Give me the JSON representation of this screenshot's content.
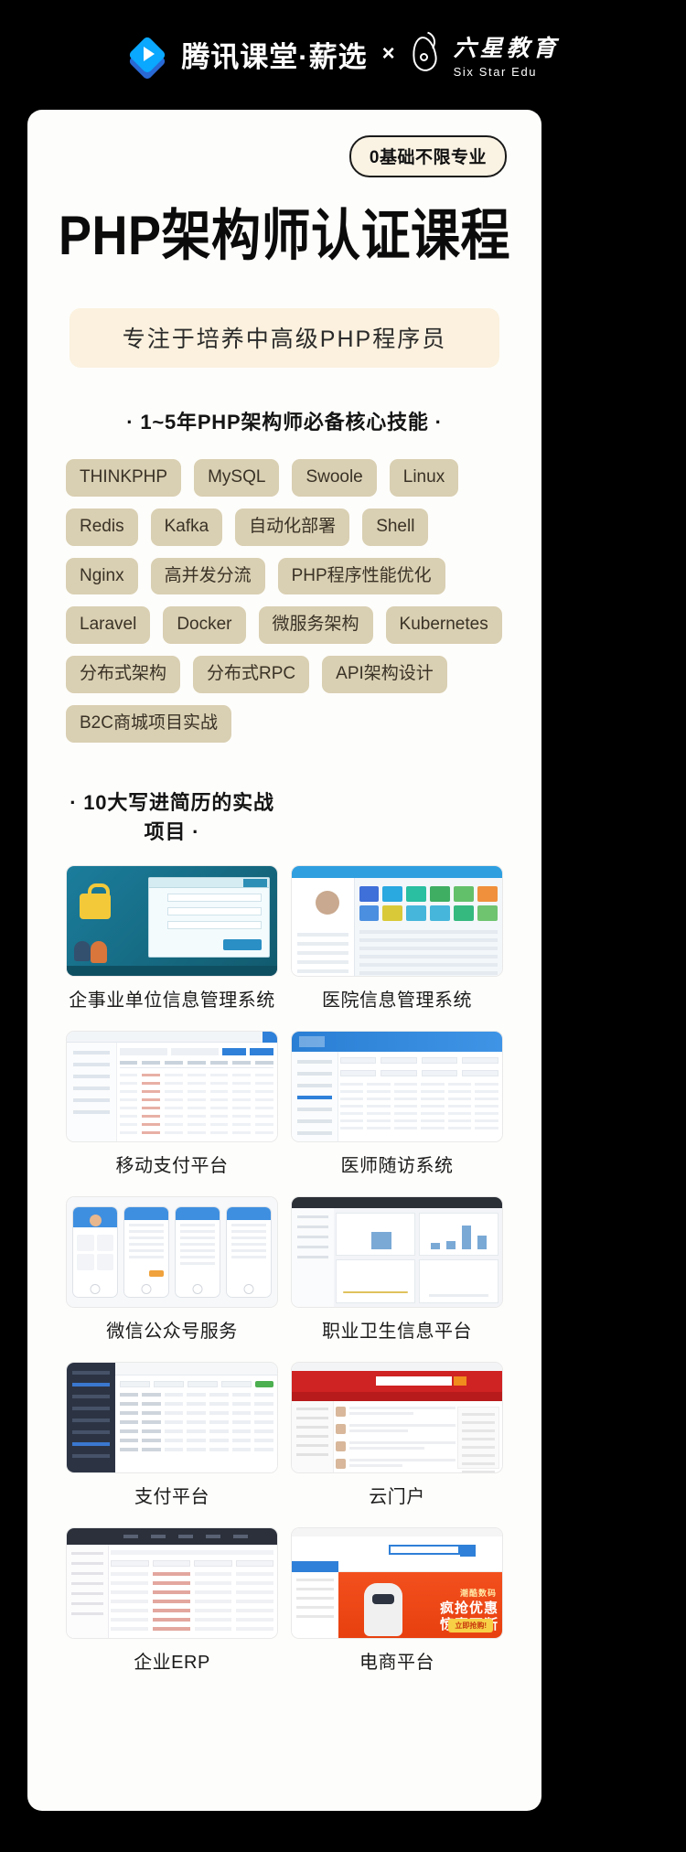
{
  "brand": {
    "tencent_name": "腾讯课堂·薪选",
    "cross": "×",
    "partner_cn": "六星教育",
    "partner_en": "Six Star Edu"
  },
  "hero": {
    "badge": "0基础不限专业",
    "title": "PHP架构师认证课程",
    "subtitle_band": "专注于培养中高级PHP程序员"
  },
  "skills_section": {
    "heading": "· 1~5年PHP架构师必备核心技能 ·",
    "tags": [
      "THINKPHP",
      "MySQL",
      "Swoole",
      "Linux",
      "Redis",
      "Kafka",
      "自动化部署",
      "Shell",
      "Nginx",
      "高并发分流",
      "PHP程序性能优化",
      "Laravel",
      "Docker",
      "微服务架构",
      "Kubernetes",
      "分布式架构",
      "分布式RPC",
      "API架构设计",
      "B2C商城项目实战"
    ]
  },
  "projects_section": {
    "heading": "· 10大写进简历的实战项目 ·",
    "items": [
      {
        "caption": "企事业单位信息管理系统",
        "mock": "m-login"
      },
      {
        "caption": "医院信息管理系统",
        "mock": "m-hosp"
      },
      {
        "caption": "移动支付平台",
        "mock": "m-tbl"
      },
      {
        "caption": "医师随访系统",
        "mock": "m-tcm"
      },
      {
        "caption": "微信公众号服务",
        "mock": "m-phone"
      },
      {
        "caption": "职业卫生信息平台",
        "mock": "m-chart"
      },
      {
        "caption": "支付平台",
        "mock": "m-pay"
      },
      {
        "caption": "云门户",
        "mock": "m-cloud"
      },
      {
        "caption": "企业ERP",
        "mock": "m-erp"
      },
      {
        "caption": "电商平台",
        "mock": "m-shop"
      }
    ]
  },
  "shop_banner": {
    "kicker": "潮酷数码",
    "line1": "疯抢优惠",
    "line2": "惊喜不断",
    "cta": "立即抢购!"
  },
  "colors": {
    "page_bg": "#000000",
    "card_bg": "#fdfdfb",
    "tag_bg": "#d9cfb2",
    "band_bg": "#fbf1de",
    "badge_bg": "#faf3e4",
    "title": "#0b0b0b",
    "tencent_blue": "#0aa8ff"
  }
}
